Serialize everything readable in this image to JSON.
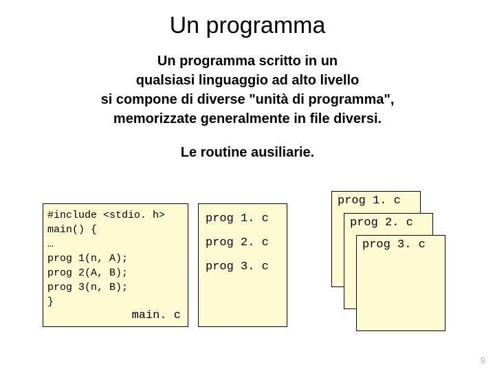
{
  "title": "Un programma",
  "intro_line1": "Un programma scritto in un",
  "intro_line2": "qualsiasi linguaggio ad alto livello",
  "intro_line3": "si compone di diverse \"unità di programma\",",
  "intro_line4": "memorizzate generalmente in file diversi.",
  "subtitle": "Le routine ausiliarie.",
  "main": {
    "code": "#include <stdio. h>\nmain() {\n…\nprog 1(n, A);\nprog 2(A, B);\nprog 3(n, B);\n}",
    "label": "main. c"
  },
  "list": {
    "item1": "prog 1. c",
    "item2": "prog 2. c",
    "item3": "prog 3. c"
  },
  "stack": {
    "file1": "prog 1. c",
    "file2": "prog 2. c",
    "file3": "prog 3. c"
  },
  "page_number": "9"
}
